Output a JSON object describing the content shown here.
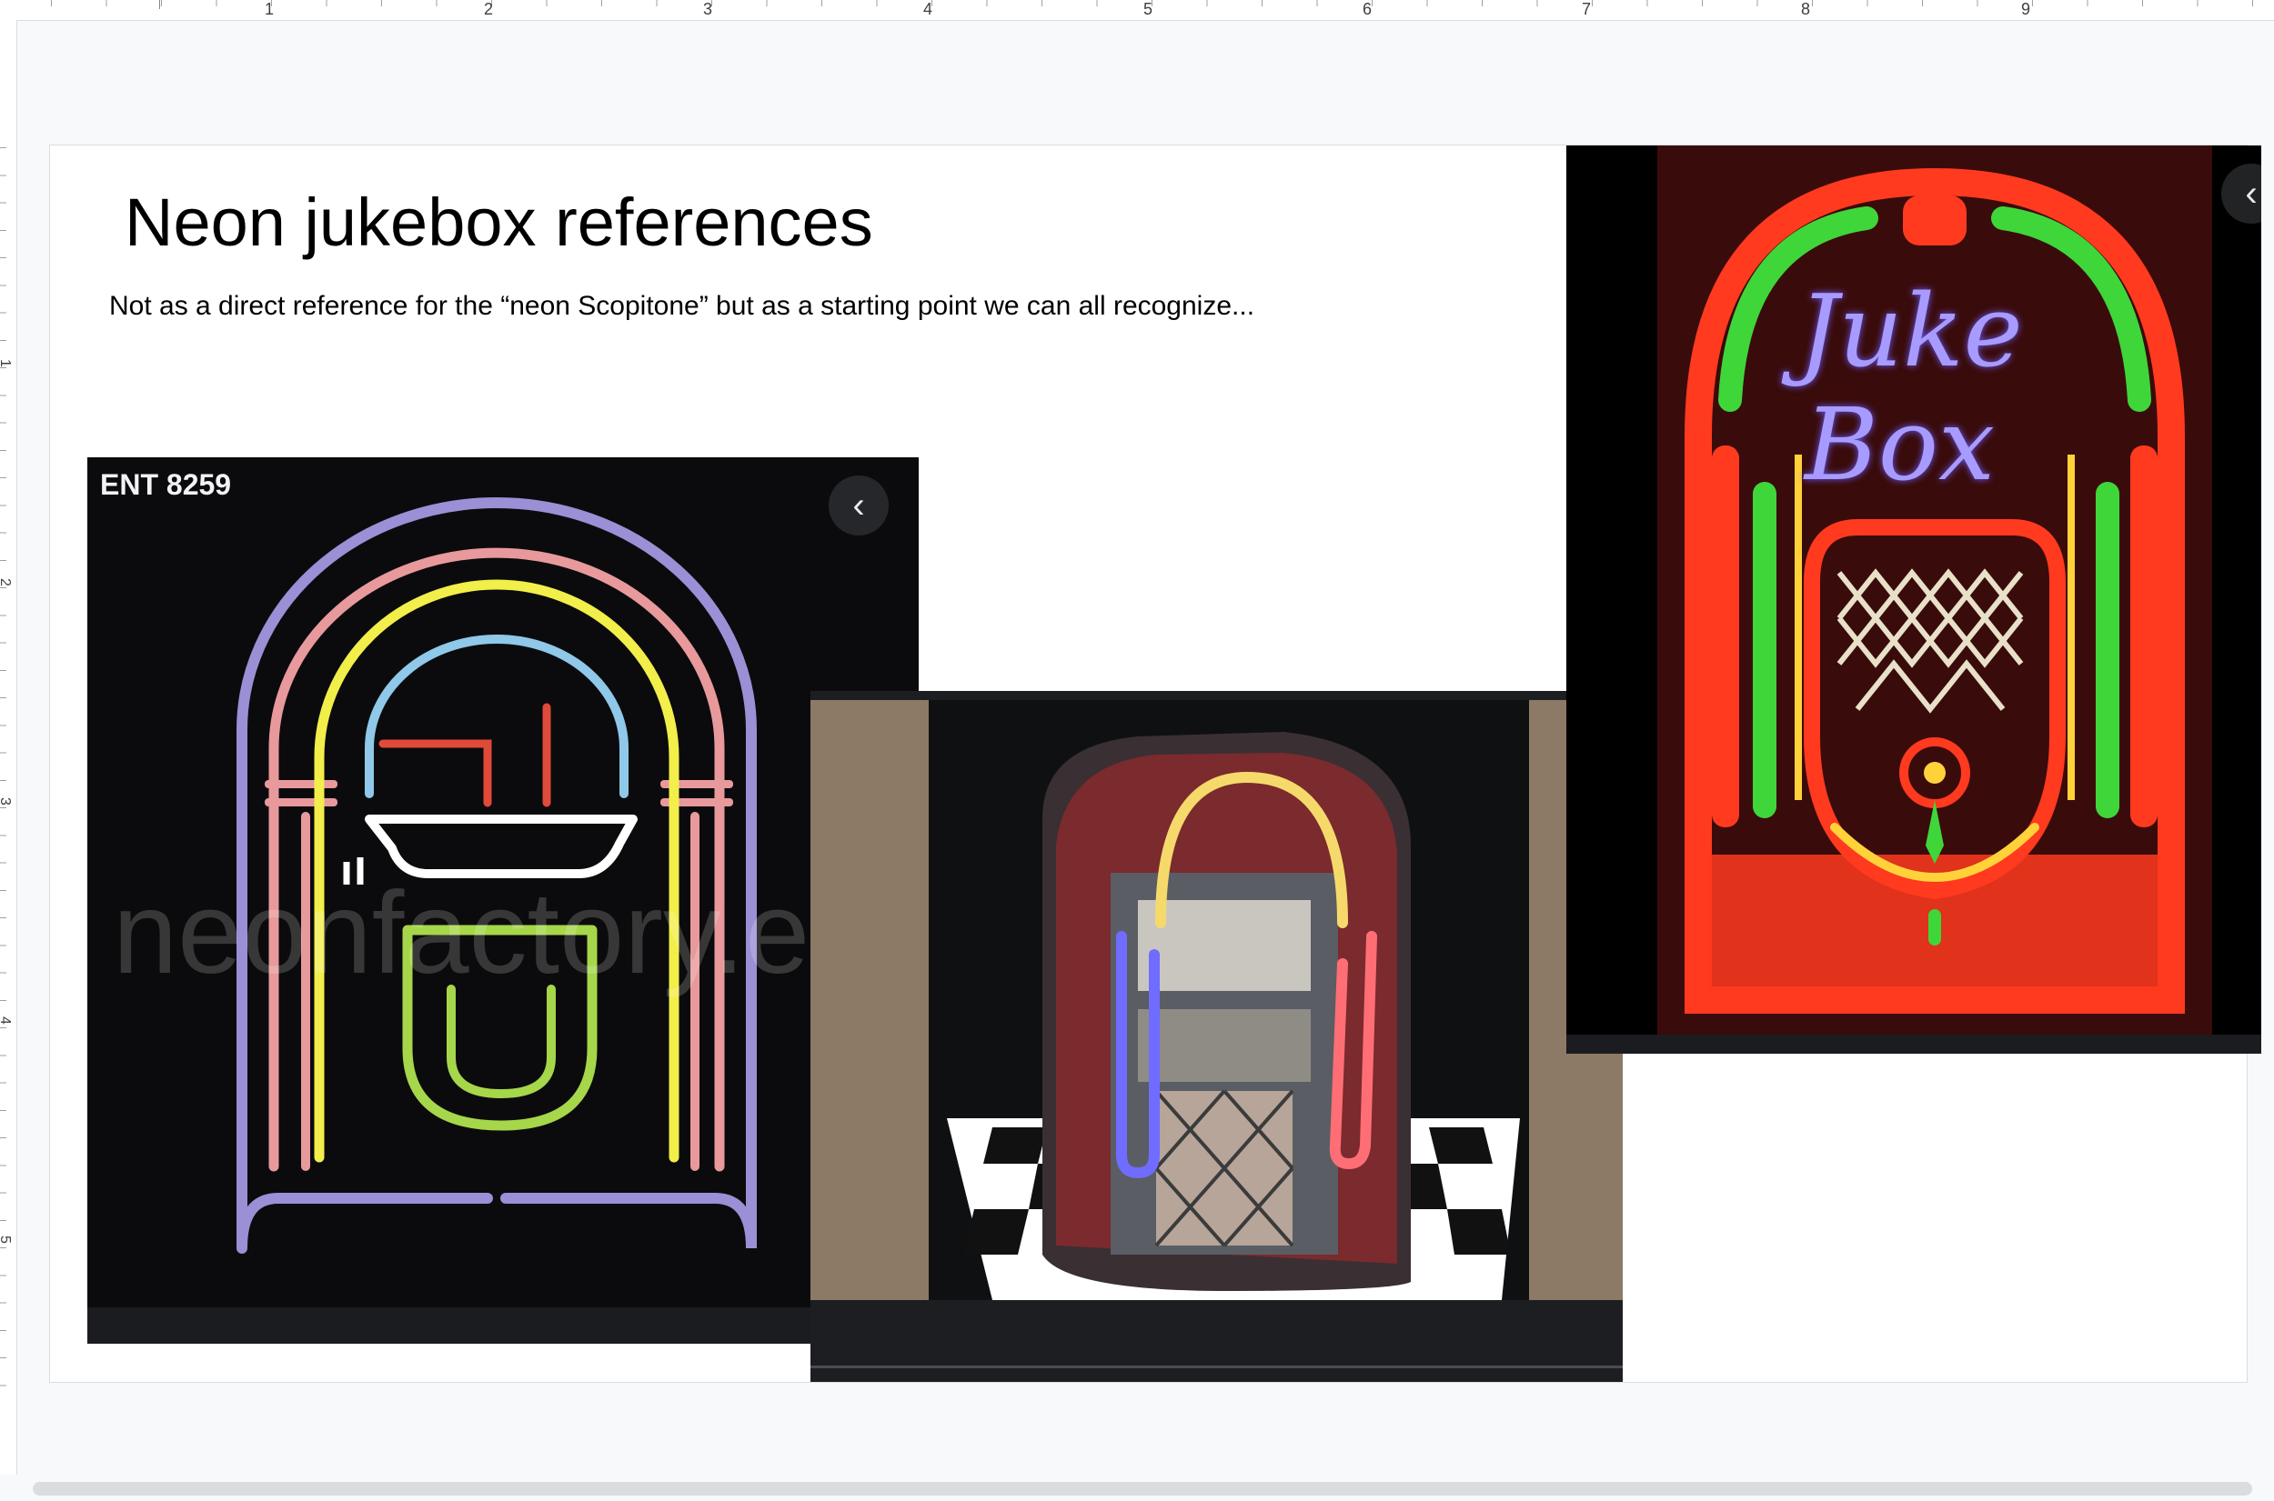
{
  "ruler": {
    "horizontal_labels": [
      "1",
      "2",
      "3",
      "4",
      "5",
      "6",
      "7",
      "8",
      "9"
    ],
    "vertical_labels": [
      "1",
      "2",
      "3",
      "4",
      "5"
    ]
  },
  "slide": {
    "title": "Neon jukebox references",
    "subtitle": "Not as a direct reference for the “neon Scopitone” but as a starting point we can all recognize..."
  },
  "images": {
    "left": {
      "label": "ENT 8259",
      "watermark": "neonfactory.e",
      "back_icon": "chevron-left-icon"
    },
    "center": {
      "description_icon": "jukebox-photo"
    },
    "right": {
      "sign_line1": "Juke",
      "sign_line2": "Box",
      "back_icon": "chevron-left-icon"
    }
  },
  "colors": {
    "page_bg": "#f8f9fa",
    "slide_bg": "#ffffff",
    "neon_purple": "#9b8fd6",
    "neon_pink": "#e8999c",
    "neon_yellow": "#f2ee4a",
    "neon_blue": "#8fc8e8",
    "neon_red": "#e04a3a",
    "neon_green": "#a6d64a"
  }
}
